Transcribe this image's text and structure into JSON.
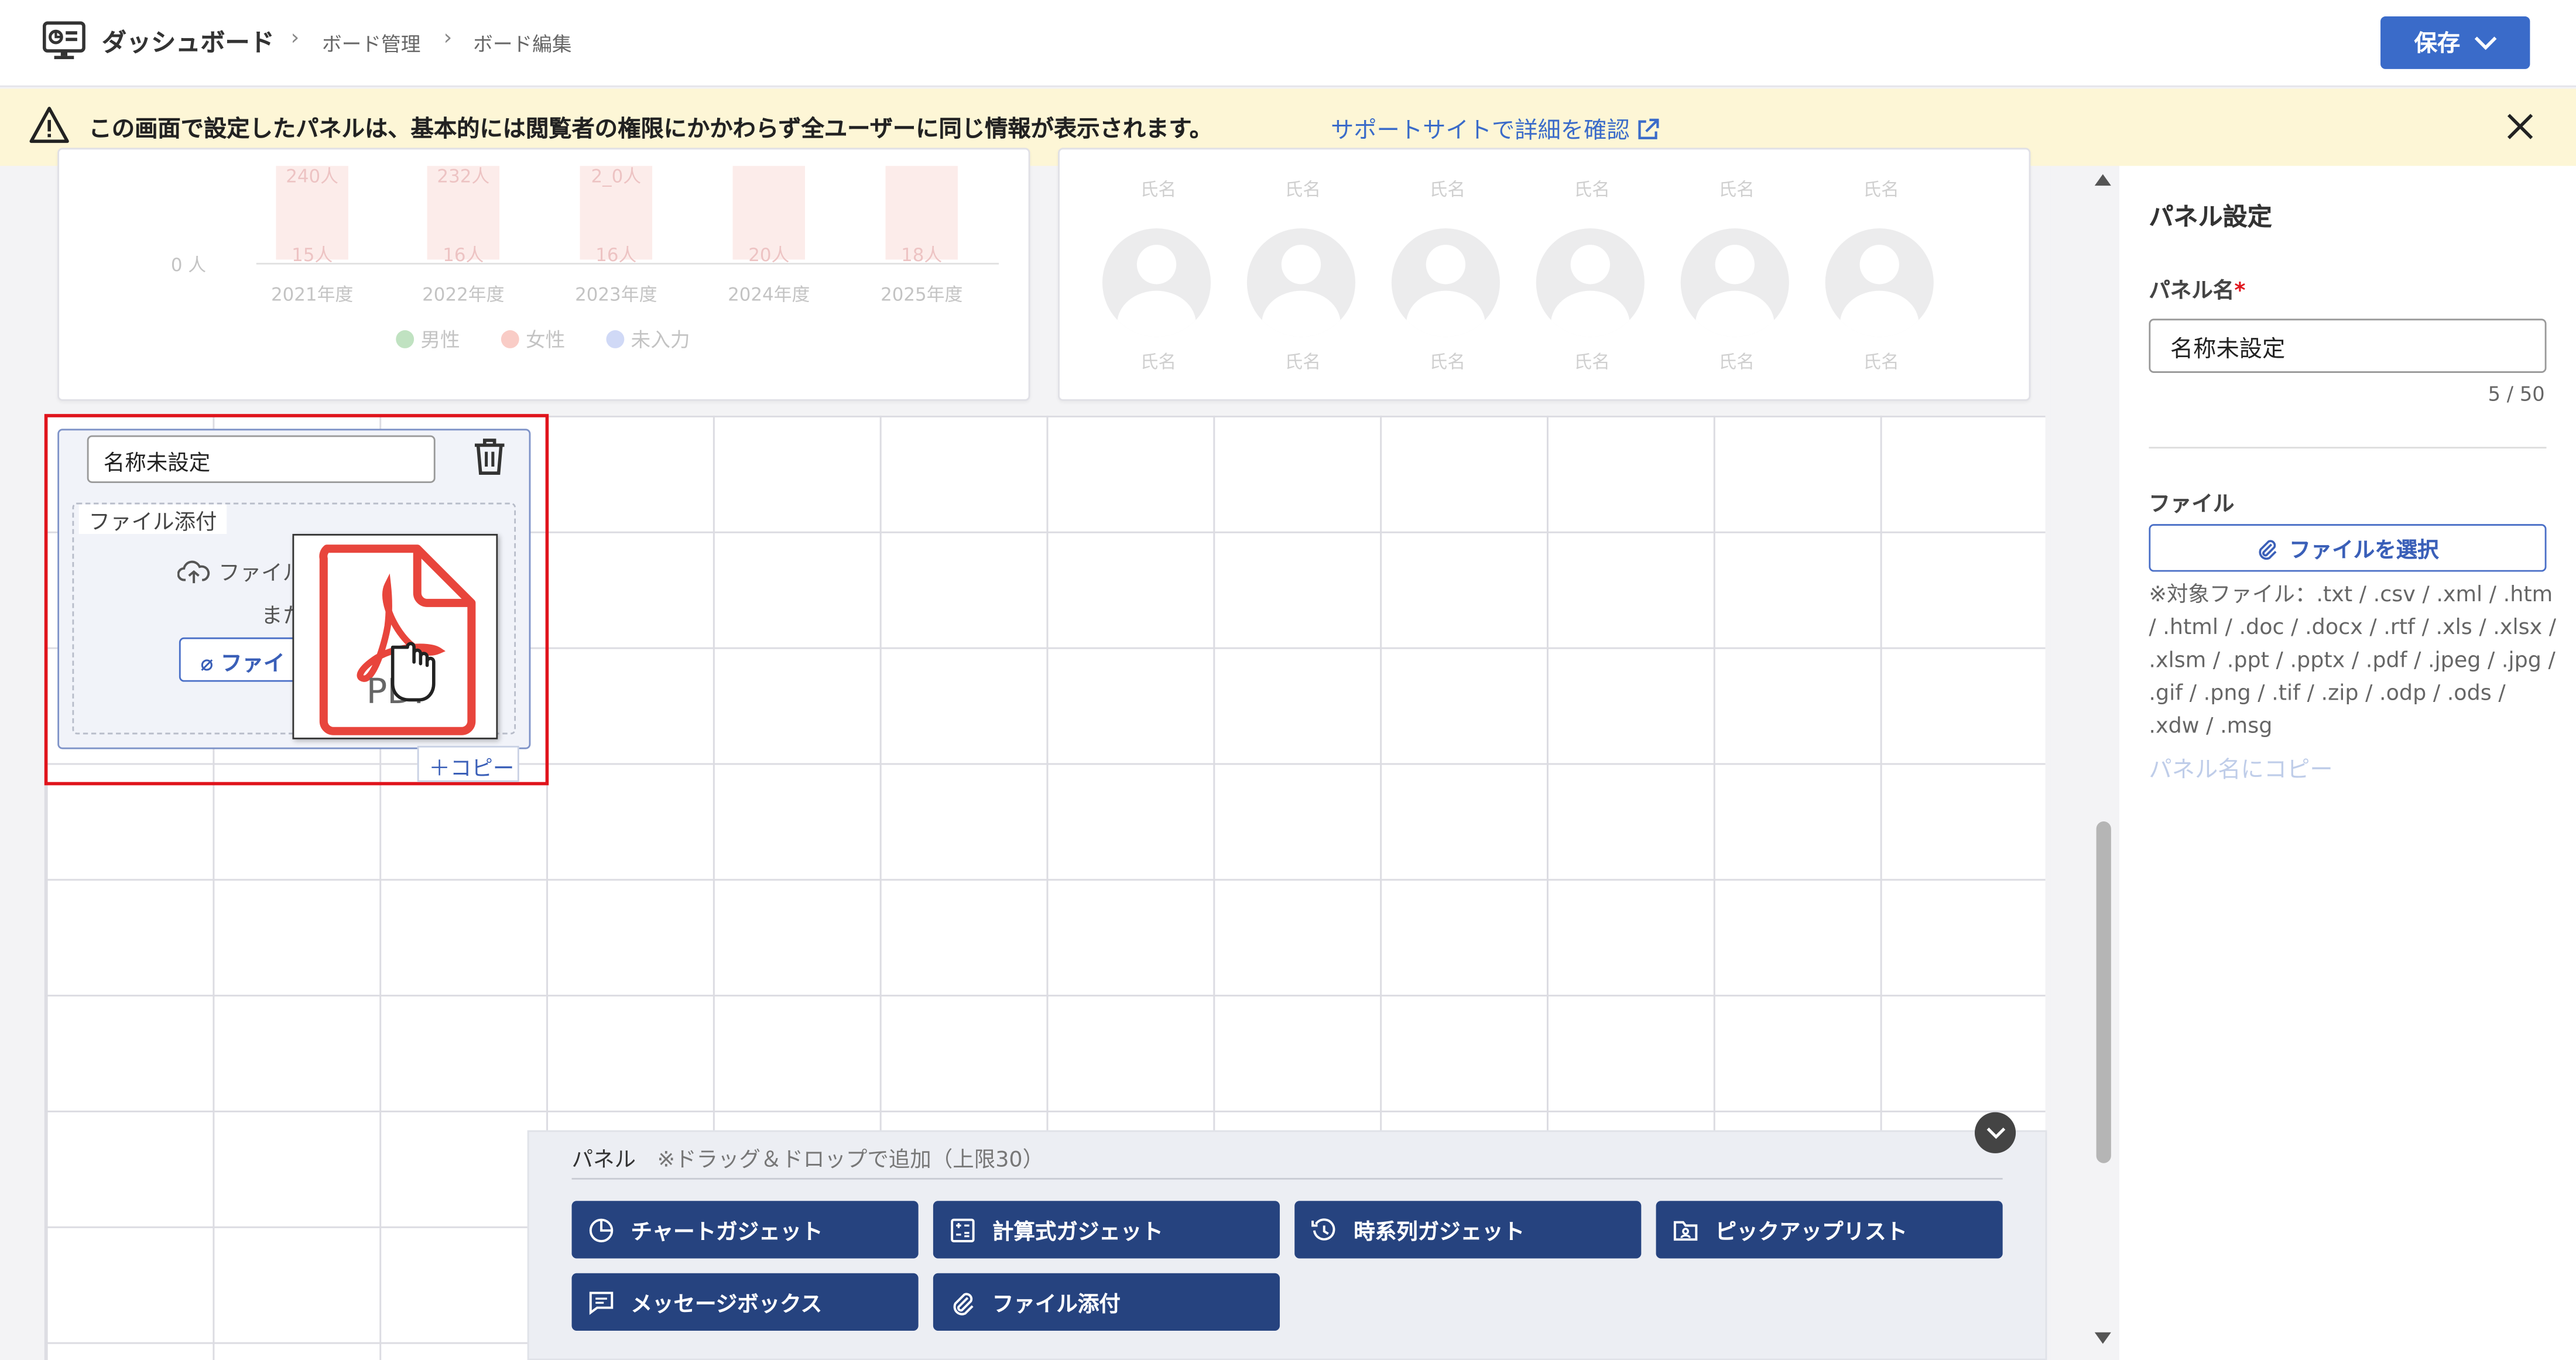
{
  "header": {
    "title": "ダッシュボード",
    "breadcrumbs": [
      "ボード管理",
      "ボード編集"
    ],
    "save_label": "保存"
  },
  "banner": {
    "message": "この画面で設定したパネルは、基本的には閲覧者の権限にかかわらず全ユーザーに同じ情報が表示されます。",
    "link": "サポートサイトで詳細を確認"
  },
  "chart_panel": {
    "y_label": "0 人",
    "years": [
      "2021年度",
      "2022年度",
      "2023年度",
      "2024年度",
      "2025年度"
    ],
    "top_values": [
      "240人",
      "232人",
      "2_0人",
      "",
      ""
    ],
    "bottom_values": [
      "15人",
      "16人",
      "16人",
      "20人",
      "18人"
    ],
    "legend": [
      "男性",
      "女性",
      "未入力"
    ],
    "colors": {
      "male": "#9fd5a4",
      "female": "#f5b1a8",
      "unset": "#b8c5ee"
    }
  },
  "people_panel": {
    "name_label": "氏名"
  },
  "widget": {
    "name": "名称未設定",
    "section_label": "ファイル添付",
    "upload_text": "ファイル",
    "or_text": "また",
    "select_button": "ファイ",
    "drag_icon_text": "PDF",
    "copy_label": "コピー"
  },
  "palette": {
    "title": "パネル",
    "note": "※ドラッグ＆ドロップで追加（上限30）",
    "gadgets": [
      {
        "label": "チャートガジェット",
        "icon": "pie-chart-icon"
      },
      {
        "label": "計算式ガジェット",
        "icon": "calculator-icon"
      },
      {
        "label": "時系列ガジェット",
        "icon": "history-icon"
      },
      {
        "label": "ピックアップリスト",
        "icon": "person-folder-icon"
      },
      {
        "label": "メッセージボックス",
        "icon": "message-icon"
      },
      {
        "label": "ファイル添付",
        "icon": "paperclip-icon"
      }
    ]
  },
  "settings": {
    "title": "パネル設定",
    "panel_name_label": "パネル名",
    "required_mark": "*",
    "panel_name_value": "名称未設定",
    "counter": "5 / 50",
    "file_label": "ファイル",
    "file_button": "ファイルを選択",
    "file_note": "※対象ファイル：.txt / .csv / .xml / .htm / .html / .doc / .docx / .rtf / .xls / .xlsx / .xlsm / .ppt / .pptx / .pdf / .jpeg / .jpg / .gif / .png / .tif / .zip / .odp / .ods / .xdw / .msg",
    "copy_to_name": "パネル名にコピー"
  }
}
